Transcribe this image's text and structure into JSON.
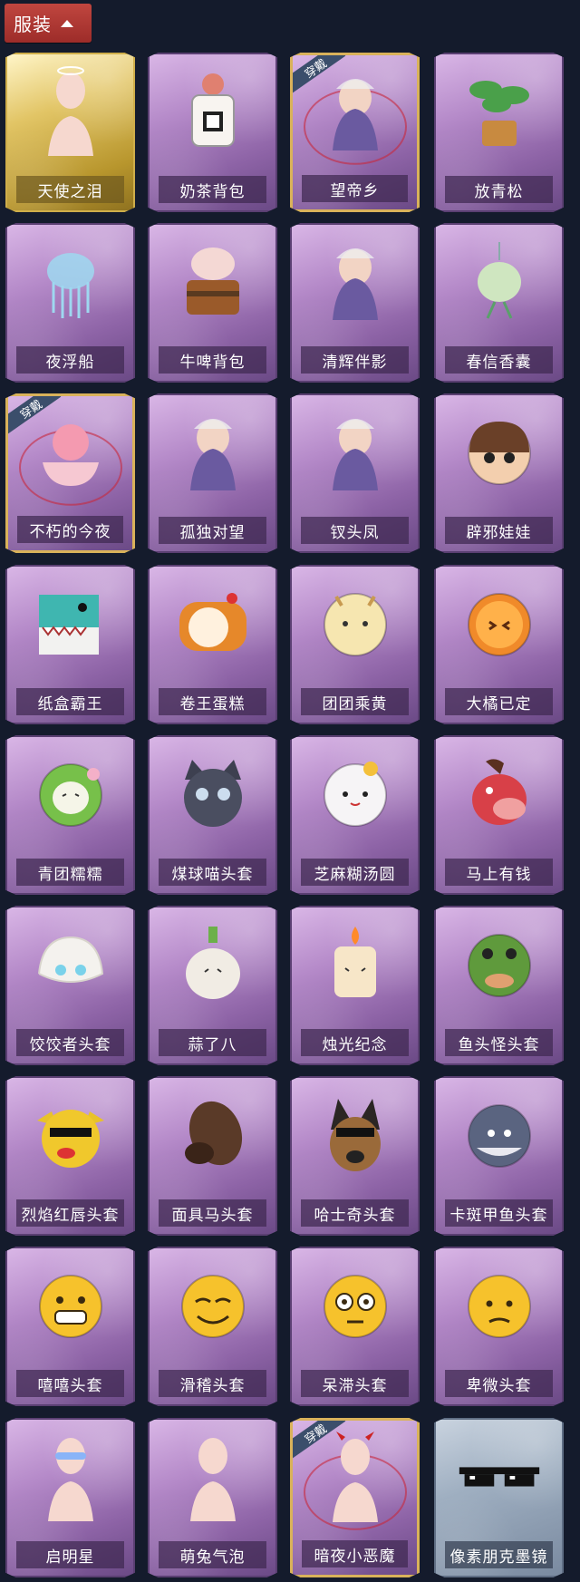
{
  "header": {
    "section_label": "服装"
  },
  "badge_text": "穿戴",
  "items": [
    {
      "name": "天使之泪",
      "icon": "angel-body-icon",
      "variant": "gold",
      "worn": false
    },
    {
      "name": "奶茶背包",
      "icon": "milk-tea-backpack-icon",
      "variant": "purple",
      "worn": false
    },
    {
      "name": "望帝乡",
      "icon": "hanfu-figure-icon",
      "variant": "purple",
      "worn": true
    },
    {
      "name": "放青松",
      "icon": "pine-bonsai-icon",
      "variant": "purple",
      "worn": false
    },
    {
      "name": "夜浮船",
      "icon": "jellyfish-icon",
      "variant": "purple",
      "worn": false
    },
    {
      "name": "牛啤背包",
      "icon": "cow-beer-mug-icon",
      "variant": "purple",
      "worn": false
    },
    {
      "name": "清辉伴影",
      "icon": "fox-girl-charm-icon",
      "variant": "purple",
      "worn": false
    },
    {
      "name": "春信香囊",
      "icon": "sachet-icon",
      "variant": "purple",
      "worn": false
    },
    {
      "name": "不朽的今夜",
      "icon": "pink-cat-bowl-icon",
      "variant": "purple",
      "worn": true
    },
    {
      "name": "孤独对望",
      "icon": "silver-hair-charm-icon",
      "variant": "purple",
      "worn": false
    },
    {
      "name": "钗头凤",
      "icon": "phoenix-crown-icon",
      "variant": "purple",
      "worn": false
    },
    {
      "name": "辟邪娃娃",
      "icon": "doll-head-icon",
      "variant": "purple",
      "worn": false
    },
    {
      "name": "纸盒霸王",
      "icon": "box-dino-head-icon",
      "variant": "purple",
      "worn": false
    },
    {
      "name": "卷王蛋糕",
      "icon": "roll-cake-head-icon",
      "variant": "purple",
      "worn": false
    },
    {
      "name": "团团乘黄",
      "icon": "cream-bun-head-icon",
      "variant": "purple",
      "worn": false
    },
    {
      "name": "大橘已定",
      "icon": "orange-slice-head-icon",
      "variant": "purple",
      "worn": false
    },
    {
      "name": "青团糯糯",
      "icon": "green-dumpling-head-icon",
      "variant": "purple",
      "worn": false
    },
    {
      "name": "煤球喵头套",
      "icon": "black-cat-head-icon",
      "variant": "purple",
      "worn": false
    },
    {
      "name": "芝麻糊汤圆",
      "icon": "rice-ball-head-icon",
      "variant": "purple",
      "worn": false
    },
    {
      "name": "马上有钱",
      "icon": "red-horse-head-icon",
      "variant": "purple",
      "worn": false
    },
    {
      "name": "饺饺者头套",
      "icon": "dumpling-head-icon",
      "variant": "purple",
      "worn": false
    },
    {
      "name": "蒜了八",
      "icon": "garlic-head-icon",
      "variant": "purple",
      "worn": false
    },
    {
      "name": "烛光纪念",
      "icon": "candle-head-icon",
      "variant": "purple",
      "worn": false
    },
    {
      "name": "鱼头怪头套",
      "icon": "fish-head-icon",
      "variant": "purple",
      "worn": false
    },
    {
      "name": "烈焰红唇头套",
      "icon": "yellow-mouse-head-icon",
      "variant": "purple",
      "worn": false
    },
    {
      "name": "面具马头套",
      "icon": "horse-mask-icon",
      "variant": "purple",
      "worn": false
    },
    {
      "name": "哈士奇头套",
      "icon": "husky-head-icon",
      "variant": "purple",
      "worn": false
    },
    {
      "name": "卡斑甲鱼头套",
      "icon": "whale-head-icon",
      "variant": "purple",
      "worn": false
    },
    {
      "name": "嘻嘻头套",
      "icon": "grin-emoji-icon",
      "variant": "purple",
      "worn": false
    },
    {
      "name": "滑稽头套",
      "icon": "smirk-emoji-icon",
      "variant": "purple",
      "worn": false
    },
    {
      "name": "呆滞头套",
      "icon": "dazed-emoji-icon",
      "variant": "purple",
      "worn": false
    },
    {
      "name": "卑微头套",
      "icon": "humble-emoji-icon",
      "variant": "purple",
      "worn": false
    },
    {
      "name": "启明星",
      "icon": "star-glasses-body-icon",
      "variant": "purple",
      "worn": false
    },
    {
      "name": "萌兔气泡",
      "icon": "bunny-bubble-body-icon",
      "variant": "purple",
      "worn": false
    },
    {
      "name": "暗夜小恶魔",
      "icon": "devil-body-icon",
      "variant": "purple",
      "worn": true
    },
    {
      "name": "像素朋克墨镜",
      "icon": "pixel-sunglasses-icon",
      "variant": "grey",
      "worn": false
    }
  ],
  "colors": {
    "accent": "#b8362f",
    "worn_badge": "#3b4e6b"
  }
}
